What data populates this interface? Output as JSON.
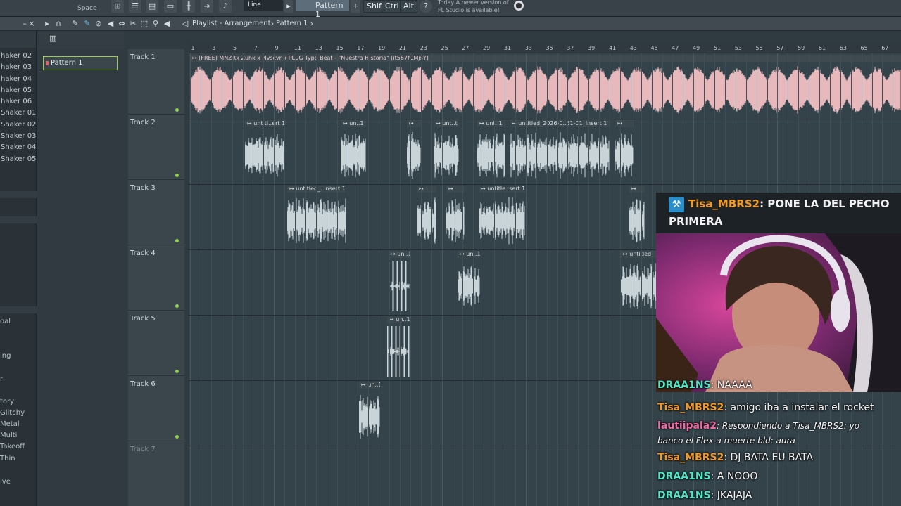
{
  "toolbar": {
    "space_label": "Space",
    "snap_value": "Line",
    "pattern_selector": "Pattern 1",
    "keys": [
      "Shift",
      "Ctrl",
      "Alt"
    ],
    "news_line1": "Today   A newer version of",
    "news_line2": "FL Studio is available!"
  },
  "playlist": {
    "title": "Playlist - Arrangement",
    "pattern": "Pattern 1",
    "pattern_list": [
      "Pattern 1"
    ]
  },
  "browser": {
    "items": [
      "haker 02",
      "haker 03",
      "haker 04",
      "haker 05",
      "haker 06",
      "Shaker 01",
      "Shaker 02",
      "Shaker 03",
      "Shaker 04",
      "Shaker 05"
    ],
    "lower_items": [
      "oal",
      "ing",
      "r",
      "tory",
      "Glitchy",
      "Metal",
      "Multi",
      "Takeoff",
      "Thin",
      "ive"
    ]
  },
  "ruler_ticks": [
    "1",
    "3",
    "5",
    "7",
    "9",
    "11",
    "13",
    "15",
    "17",
    "19",
    "21",
    "23",
    "25",
    "27",
    "29",
    "31",
    "33",
    "35",
    "37",
    "39",
    "41",
    "43",
    "45",
    "47",
    "49",
    "51",
    "53",
    "55",
    "57",
    "59",
    "61",
    "63",
    "65",
    "67"
  ],
  "tracks": [
    "Track 1",
    "Track 2",
    "Track 3",
    "Track 4",
    "Track 5",
    "Track 6",
    "Track 7"
  ],
  "clip_titles": {
    "t1": "↦ [FREE] MNZRx Zuhk x Nvscvr x PLUG Type Beat - \"Nuestra Historia\" [it567fCMjsY]",
    "t2a": "↦ untitl..ert 1",
    "t2b": "↦ un..1",
    "t2c": "↦",
    "t2d": "↦ unt..t 1",
    "t2e": "↦ unt..1",
    "t2f": "↦ untitled_2026-0..51-01_Insert 1",
    "t2g": "↦",
    "t3a": "↦ untitled_..Insert 1",
    "t3b": "↦",
    "t3c": "↦",
    "t3d": "↦ untitle..sert 1",
    "t3e": "↦",
    "t4a": "↦ un..1",
    "t4b": "↦ un..1",
    "t4c": "↦ untitled",
    "t5a": "↦ un..1",
    "t6a": "↦ un..1"
  },
  "overlay": {
    "highlight_user": "Tisa_MBRS2",
    "highlight_text": ": PONE LA DEL PECHO PRIMERA"
  },
  "chat": [
    {
      "user": "DRAA1NS",
      "text": ": NAAAA"
    },
    {
      "user": "Tisa_MBRS2",
      "text": ": amigo iba a instalar el rocket"
    },
    {
      "user": "lautiipala2",
      "text": ": Respondiendo a Tisa_MBRS2: yo"
    },
    {
      "user": "",
      "text": "banco el Flex a muerte bld: aura"
    },
    {
      "user": "Tisa_MBRS2",
      "text": ": DJ BATA EU BATA"
    },
    {
      "user": "DRAA1NS",
      "text": ": A NOOO"
    },
    {
      "user": "DRAA1NS",
      "text": ": JKAJAJA"
    }
  ],
  "colors": {
    "accent_green": "#9acb59",
    "track1_clip": "#e7b9bd",
    "audio_clip": "#c8d4d8",
    "chat_orange": "#f39a25",
    "chat_teal": "#4ee6c6",
    "chat_pink": "#f06aa3"
  }
}
